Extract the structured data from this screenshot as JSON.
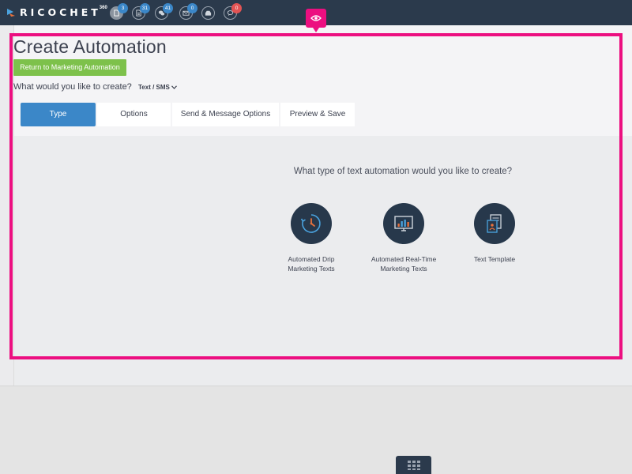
{
  "app": {
    "logo_text": "RICOCHET",
    "logo_superscript": "360"
  },
  "nav": {
    "icons": [
      {
        "name": "documents",
        "badge": "3",
        "badge_color": "#3b87c8",
        "active": true
      },
      {
        "name": "forms",
        "badge": "31",
        "badge_color": "#3b87c8"
      },
      {
        "name": "chat",
        "badge": "41",
        "badge_color": "#3b87c8"
      },
      {
        "name": "mail",
        "badge": "0",
        "badge_color": "#3b87c8"
      },
      {
        "name": "inbox",
        "badge": "",
        "badge_color": "#3b87c8"
      },
      {
        "name": "messages",
        "badge": "0",
        "badge_color": "#e25454"
      }
    ]
  },
  "page": {
    "title": "Create Automation",
    "return_button": "Return to Marketing Automation",
    "create_label": "What would you like to create?",
    "create_select_value": "Text / SMS"
  },
  "tabs": [
    {
      "label": "Type",
      "active": true
    },
    {
      "label": "Options"
    },
    {
      "label": "Send & Message Options"
    },
    {
      "label": "Preview & Save"
    }
  ],
  "type_panel": {
    "question": "What type of text automation would you like to create?",
    "choices": [
      {
        "line1": "Automated Drip",
        "line2": "Marketing Texts",
        "icon": "clock-refresh-icon"
      },
      {
        "line1": "Automated Real-Time",
        "line2": "Marketing Texts",
        "icon": "monitor-chart-icon"
      },
      {
        "line1": "Text Template",
        "line2": "",
        "icon": "document-template-icon"
      }
    ]
  },
  "colors": {
    "topbar": "#2b3a4c",
    "accent_blue": "#3b87c8",
    "return_green": "#7dc14b",
    "highlight_pink": "#ec0f80",
    "icon_orange": "#e8713c",
    "icon_blue": "#4aa3df"
  }
}
